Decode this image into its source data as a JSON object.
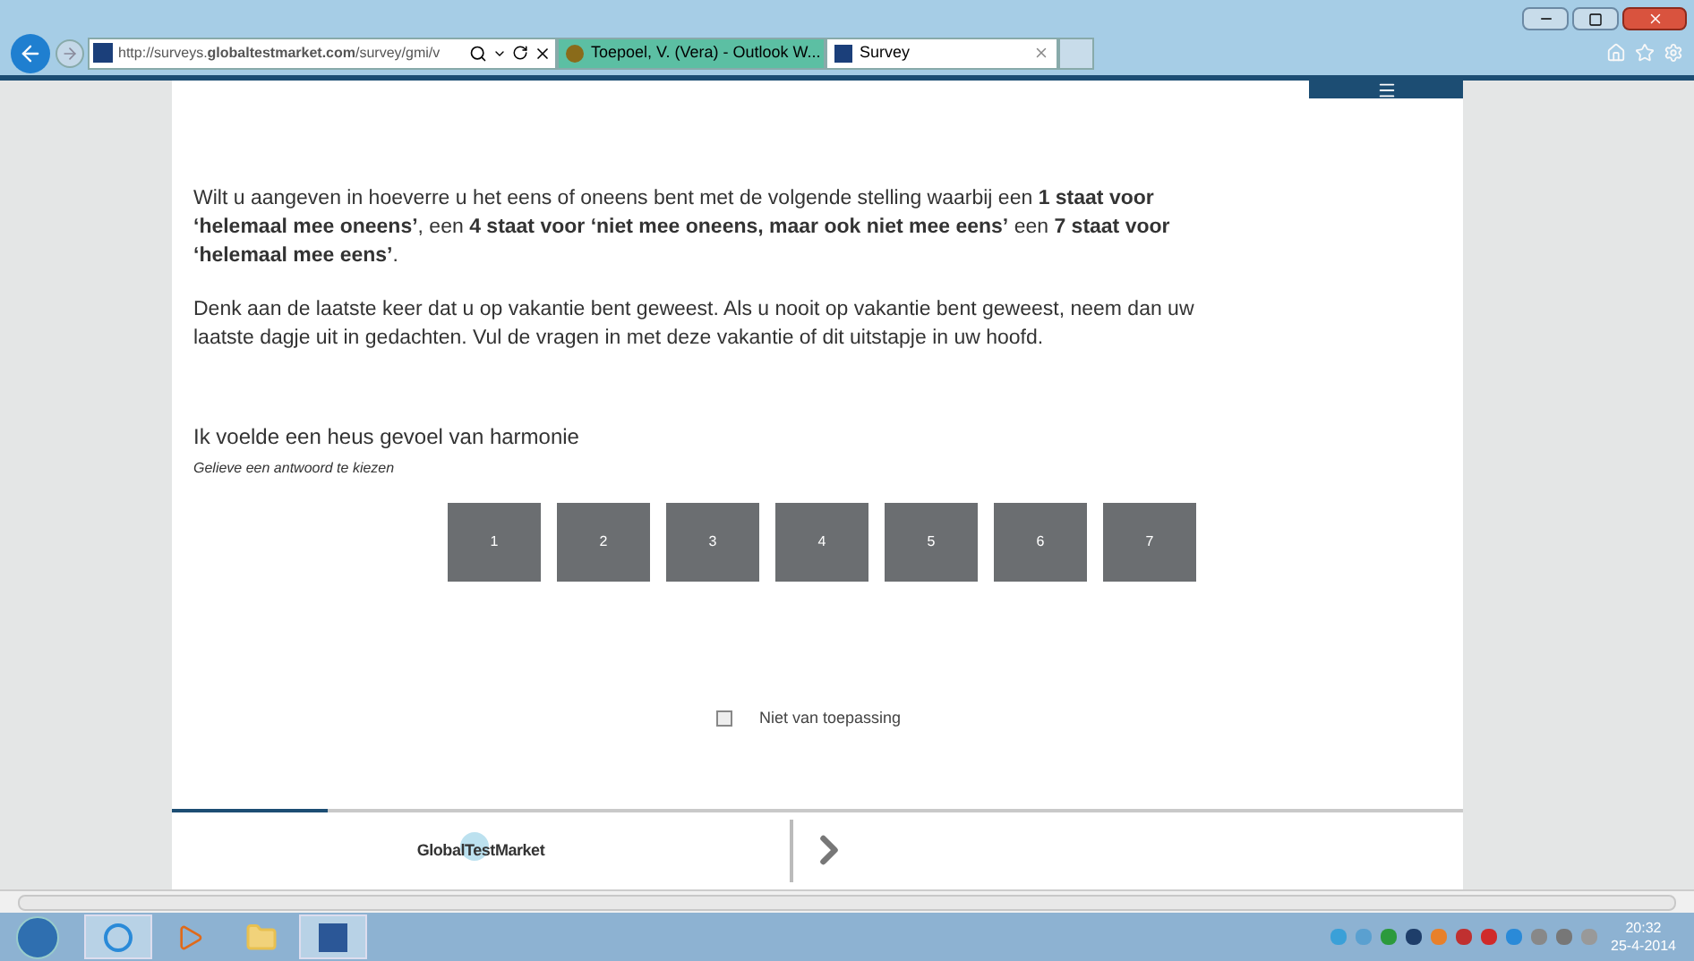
{
  "browser": {
    "address": "http://surveys.**globaltestmarket.com**/survey/gmi/v",
    "tabs": [
      {
        "label": "Toepoel, V. (Vera) - Outlook W...",
        "selected": false
      },
      {
        "label": "Survey",
        "selected": true
      }
    ]
  },
  "survey": {
    "intro": "Wilt u aangeven in hoeverre u het eens of oneens bent met de volgende stelling waarbij een **1 staat voor ‘helemaal mee oneens’**, een **4 staat voor ‘niet mee oneens, maar ook niet mee eens’** een **7 staat voor ‘helemaal mee eens’**.",
    "instruction": "Denk aan de laatste keer dat u op vakantie bent geweest. Als u nooit op vakantie bent geweest, neem dan uw laatste dagje uit in gedachten. Vul de vragen in met deze vakantie of dit uitstapje in uw hoofd.",
    "question": "Ik voelde een heus gevoel van harmonie",
    "hint": "Gelieve een antwoord te kiezen",
    "options": [
      {
        "label": "1",
        "selected": false
      },
      {
        "label": "2",
        "selected": false
      },
      {
        "label": "3",
        "selected": false
      },
      {
        "label": "4",
        "selected": false
      },
      {
        "label": "5",
        "selected": false
      },
      {
        "label": "6",
        "selected": false
      },
      {
        "label": "7",
        "selected": false
      }
    ],
    "not_applicable": {
      "label": "Niet van toepassing",
      "checked": false
    },
    "progress": {
      "level": 0.12
    },
    "logo": "GlobalTestMarket"
  },
  "taskbar": {
    "time": "20:32",
    "date": "25-4-2014"
  }
}
